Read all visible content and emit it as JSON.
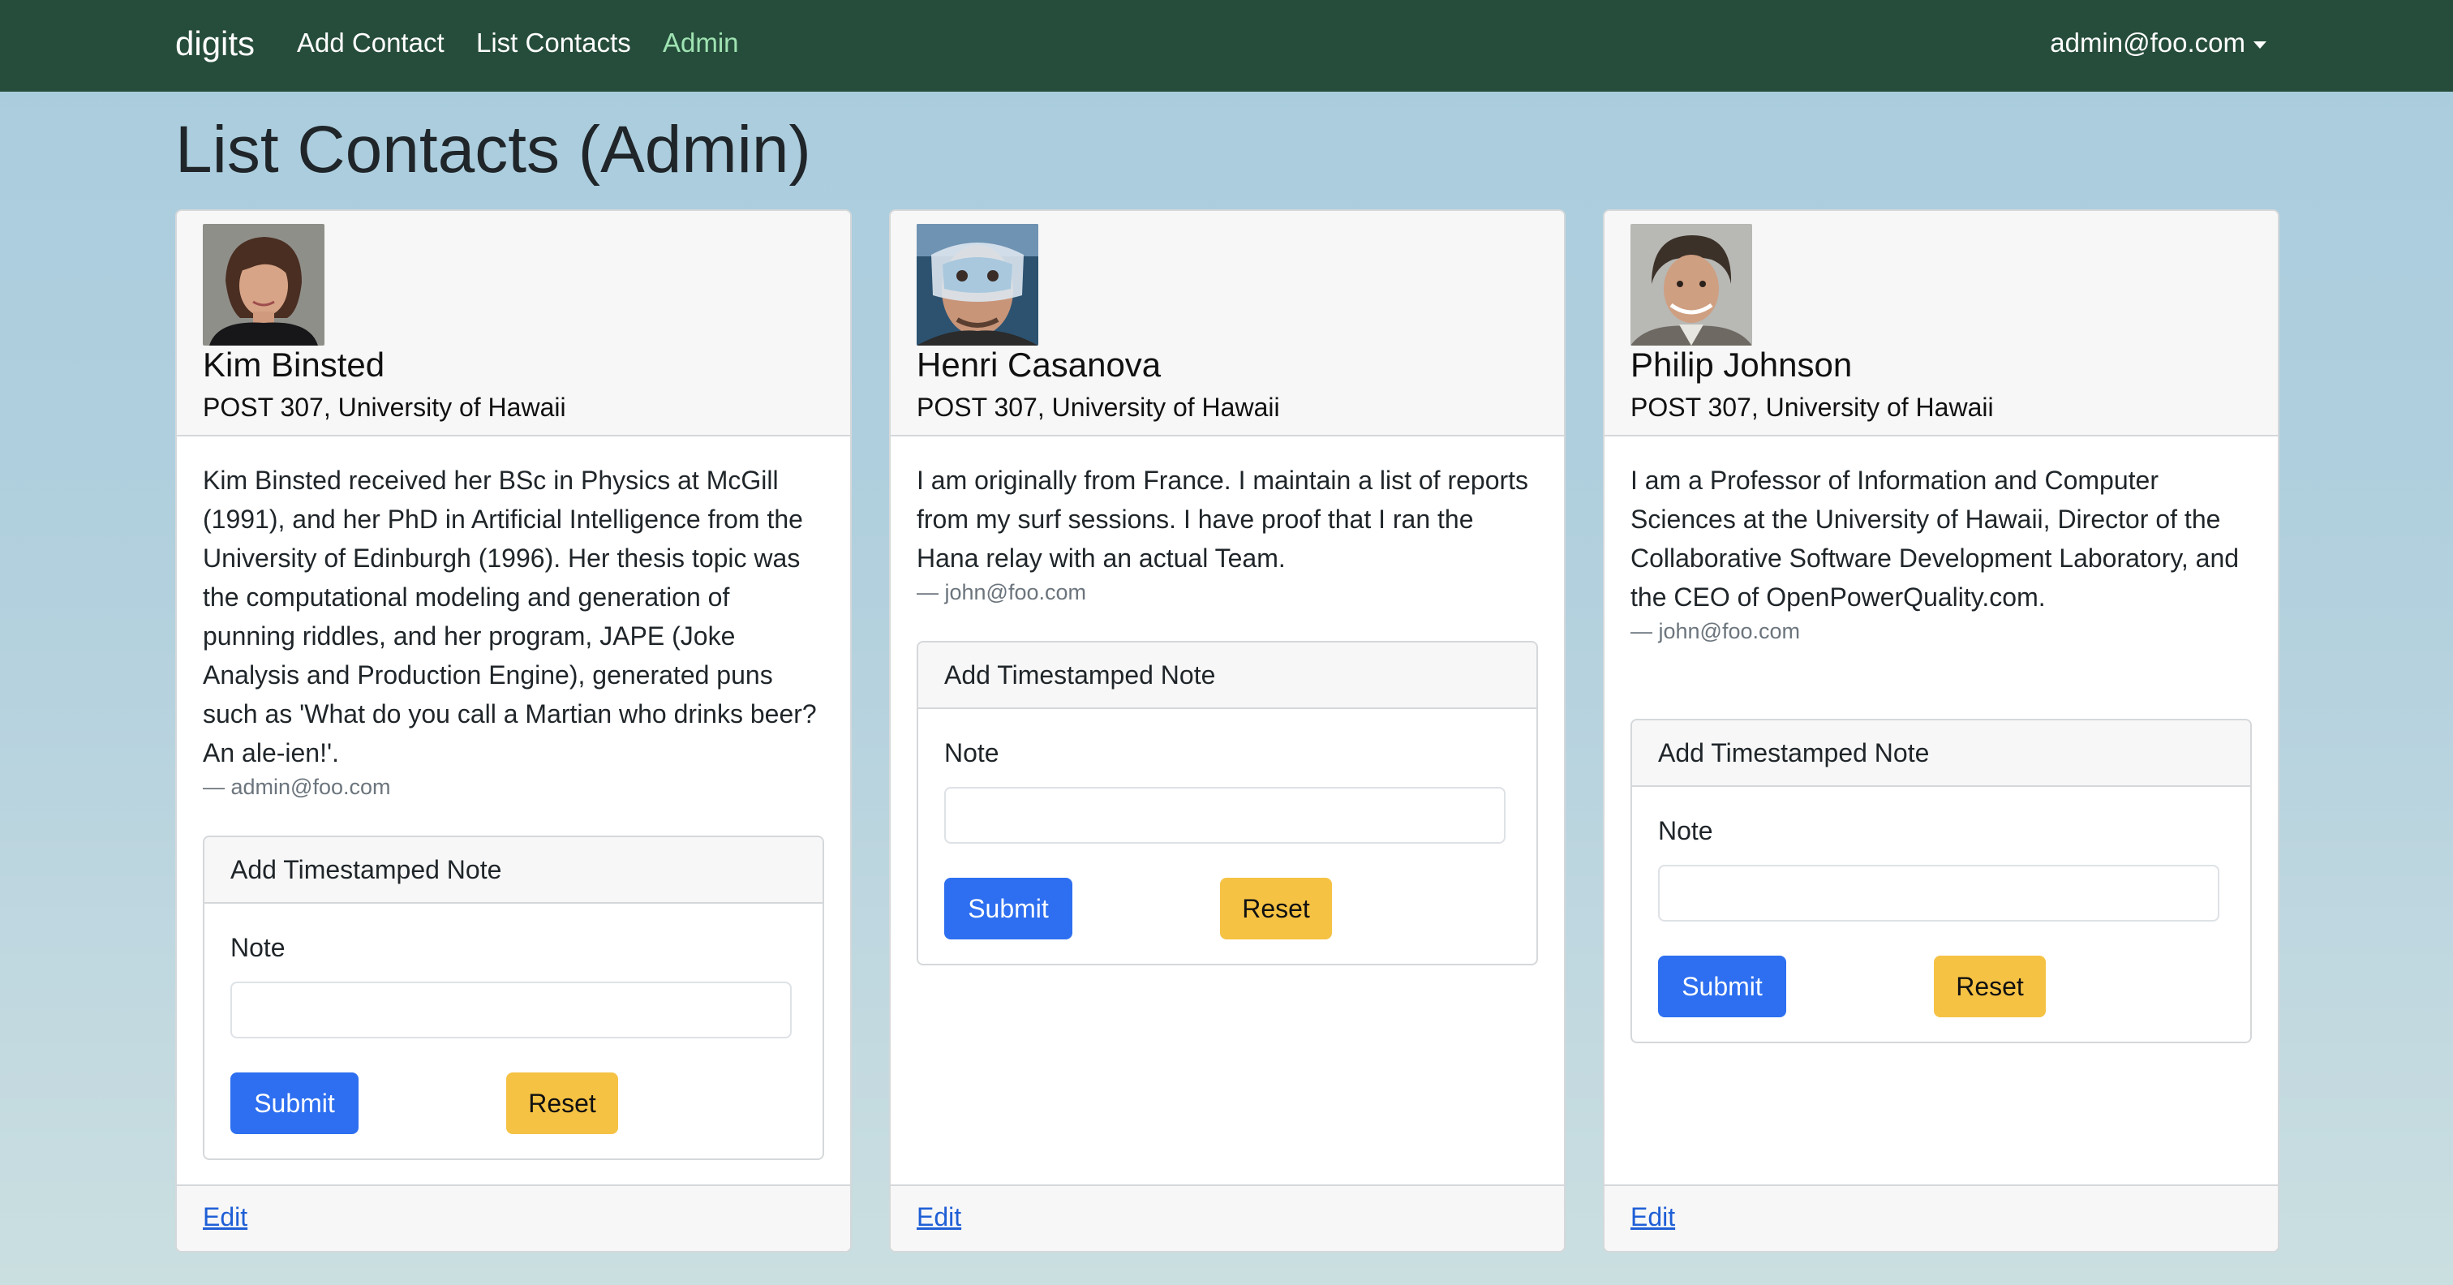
{
  "navbar": {
    "brand": "digits",
    "links": [
      {
        "label": "Add Contact",
        "active": false
      },
      {
        "label": "List Contacts",
        "active": false
      },
      {
        "label": "Admin",
        "active": true
      }
    ],
    "user": "admin@foo.com",
    "user_icon": "chevron-down-icon"
  },
  "page": {
    "title": "List Contacts (Admin)"
  },
  "contacts": [
    {
      "name": "Kim Binsted",
      "address": "POST 307, University of Hawaii",
      "description": "Kim Binsted received her BSc in Physics at McGill (1991), and her PhD in Artificial Intelligence from the University of Edinburgh (1996). Her thesis topic was the computational modeling and generation of punning riddles, and her program, JAPE (Joke Analysis and Production Engine), generated puns such as 'What do you call a Martian who drinks beer? An ale-ien!'.",
      "owner": "— admin@foo.com",
      "note_form": {
        "title": "Add Timestamped Note",
        "label": "Note",
        "value": "",
        "submit": "Submit",
        "reset": "Reset"
      },
      "edit": "Edit"
    },
    {
      "name": "Henri Casanova",
      "address": "POST 307, University of Hawaii",
      "description": "I am originally from France. I maintain a list of reports from my surf sessions. I have proof that I ran the Hana relay with an actual Team.",
      "owner": "— john@foo.com",
      "note_form": {
        "title": "Add Timestamped Note",
        "label": "Note",
        "value": "",
        "submit": "Submit",
        "reset": "Reset"
      },
      "edit": "Edit"
    },
    {
      "name": "Philip Johnson",
      "address": "POST 307, University of Hawaii",
      "description": "I am a Professor of Information and Computer Sciences at the University of Hawaii, Director of the Collaborative Software Development Laboratory, and the CEO of OpenPowerQuality.com.",
      "owner": "— john@foo.com",
      "note_form": {
        "title": "Add Timestamped Note",
        "label": "Note",
        "value": "",
        "submit": "Submit",
        "reset": "Reset"
      },
      "edit": "Edit"
    }
  ],
  "colors": {
    "navbar": "#264d3b",
    "active_link": "#9fe3b2",
    "submit": "#2d6ff0",
    "reset": "#f5c244",
    "link": "#1f5fd6"
  }
}
